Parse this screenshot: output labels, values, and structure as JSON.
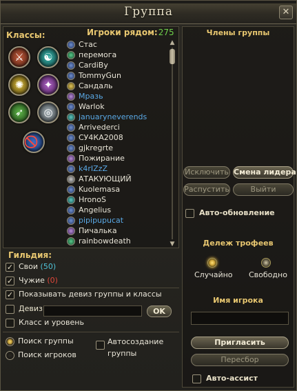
{
  "window": {
    "title": "Группа",
    "close_glyph": "✕"
  },
  "left": {
    "classes_title": "Классы:",
    "players_title": "Игроки рядом:",
    "players_count": "275",
    "class_icons": [
      "class-warrior-icon",
      "class-mystic-icon",
      "class-priest-icon",
      "class-sorcerer-icon",
      "class-ranger-icon",
      "class-lancer-icon"
    ],
    "players": [
      {
        "name": "Стас",
        "icon": "blue",
        "link": false
      },
      {
        "name": "перемога",
        "icon": "green",
        "link": false
      },
      {
        "name": "CardiBy",
        "icon": "blue",
        "link": false
      },
      {
        "name": "TommyGun",
        "icon": "blue",
        "link": false
      },
      {
        "name": "Сандаль",
        "icon": "gold",
        "link": false
      },
      {
        "name": "Мразь",
        "icon": "purple",
        "link": true
      },
      {
        "name": "Warlok",
        "icon": "blue",
        "link": false
      },
      {
        "name": "januaryneverends",
        "icon": "teal",
        "link": true
      },
      {
        "name": "Arrivederci",
        "icon": "blue",
        "link": false
      },
      {
        "name": "СУ4КА2008",
        "icon": "blue",
        "link": false
      },
      {
        "name": "gjkregrte",
        "icon": "blue",
        "link": false
      },
      {
        "name": "Пожирание",
        "icon": "purple",
        "link": false
      },
      {
        "name": "k4rIZzZ",
        "icon": "blue",
        "link": true
      },
      {
        "name": "АТАКУЮЩИЙ",
        "icon": "grey",
        "link": false
      },
      {
        "name": "Kuolemasa",
        "icon": "blue",
        "link": false
      },
      {
        "name": "HronoS",
        "icon": "teal",
        "link": false
      },
      {
        "name": "Angelius",
        "icon": "blue",
        "link": false
      },
      {
        "name": "pipipupucat",
        "icon": "blue",
        "link": true
      },
      {
        "name": "Пичалька",
        "icon": "purple",
        "link": false
      },
      {
        "name": "rainbowdeath",
        "icon": "green",
        "link": false
      }
    ]
  },
  "guild": {
    "title": "Гильдия:",
    "own_label": "Свои",
    "own_count": "(50)",
    "foreign_label": "Чужие",
    "foreign_count": "(0)",
    "show_motto_label": "Показывать девиз группы и классы",
    "motto_label": "Девиз",
    "motto_value": "",
    "ok_label": "OK",
    "class_level_label": "Класс и уровень",
    "search_group_label": "Поиск группы",
    "search_players_label": "Поиск игроков",
    "auto_create_line1": "Автосоздание",
    "auto_create_line2": "группы"
  },
  "right": {
    "members_title": "Члены группы",
    "kick_label": "Исключить",
    "change_leader_label": "Смена лидера",
    "disband_label": "Распустить",
    "leave_label": "Выйти",
    "auto_update_label": "Авто-обновление",
    "loot_title": "Дележ трофеев",
    "loot_random": "Случайно",
    "loot_free": "Свободно",
    "player_name_title": "Имя игрока",
    "player_name_value": "",
    "invite_label": "Пригласить",
    "reselect_label": "Пересбор",
    "auto_assist_label": "Авто-ассист"
  },
  "colors": {
    "accent": "#e8c770",
    "count": "#6fd14b",
    "link": "#5aa9e6",
    "own_count": "#4fc3d8",
    "foreign_count": "#e0473a"
  }
}
